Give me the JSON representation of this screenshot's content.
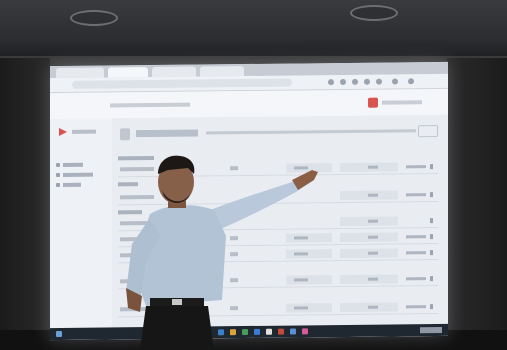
{
  "scene": {
    "description_free": true
  },
  "screen": {
    "ui_colors": {
      "accent_red": "#d9534f",
      "sidebar_bg": "#eef1f5",
      "content_bg": "#e9edf2",
      "taskbar_bg": "#1f2730"
    },
    "sidebar_item_count": 3,
    "table_row_count": 10
  }
}
